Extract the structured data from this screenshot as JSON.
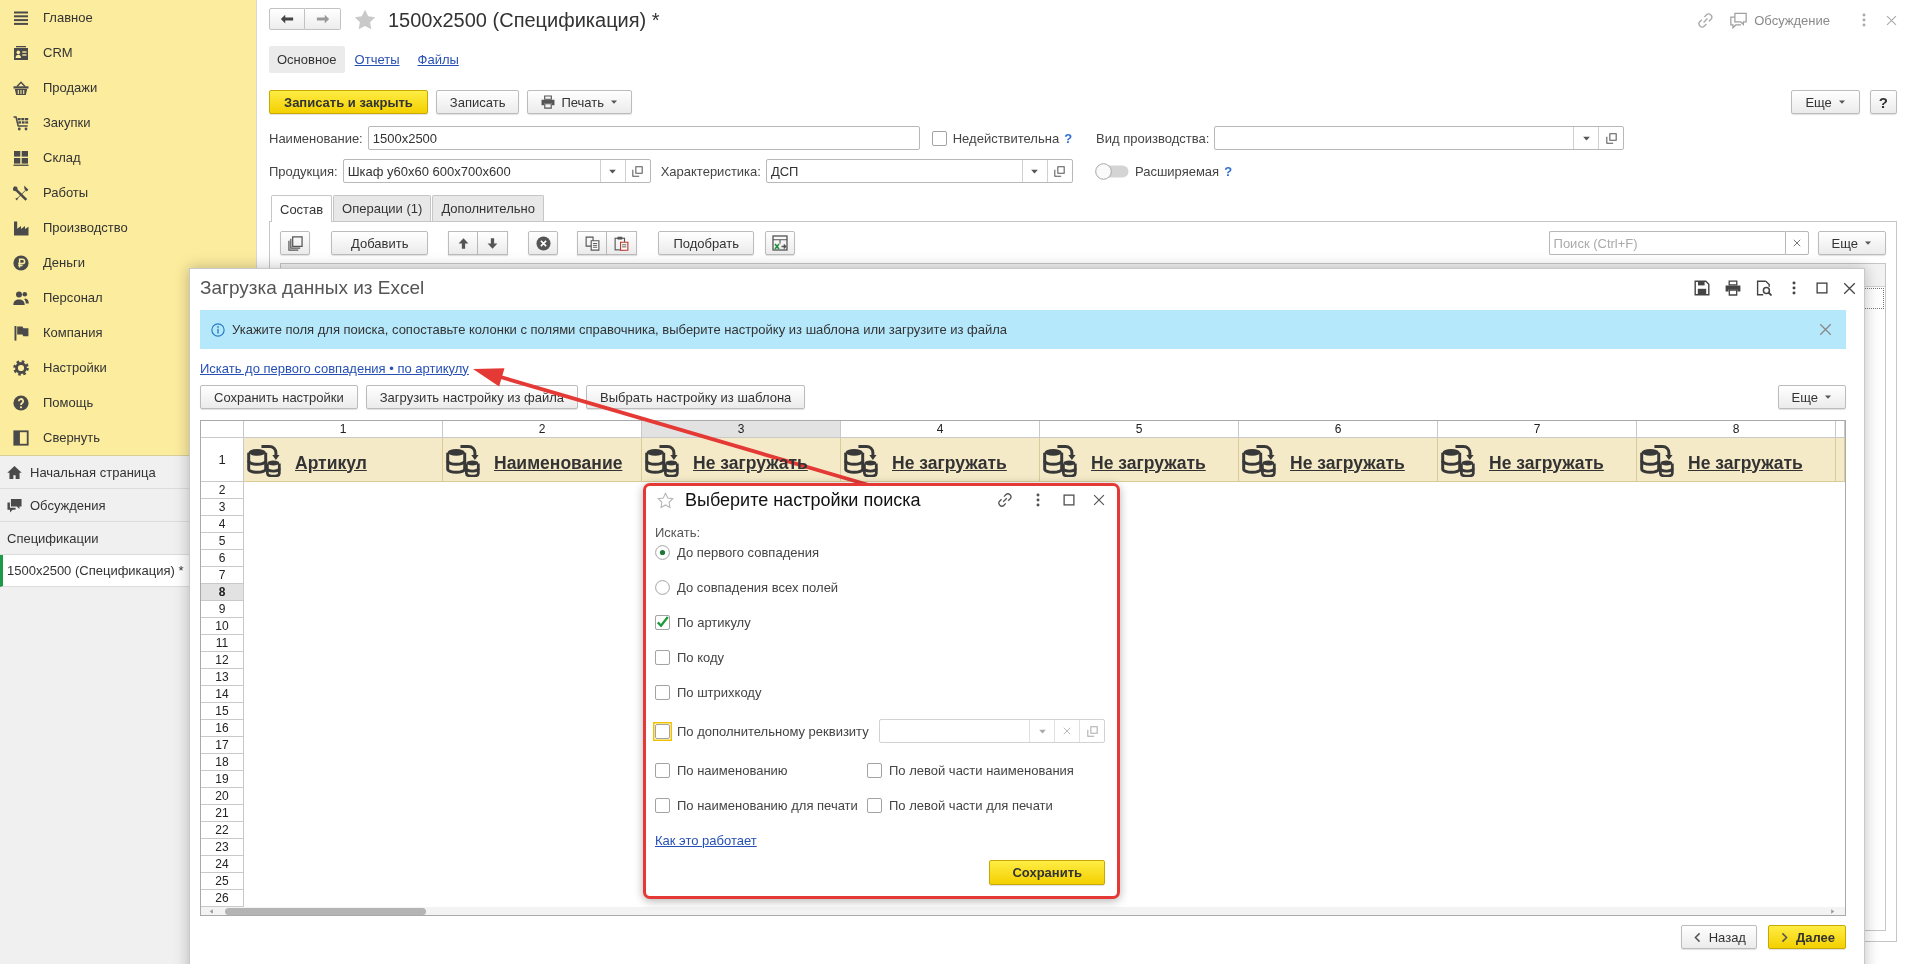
{
  "sidebar": {
    "sections": [
      {
        "label": "Главное"
      },
      {
        "label": "CRM"
      },
      {
        "label": "Продажи"
      },
      {
        "label": "Закупки"
      },
      {
        "label": "Склад"
      },
      {
        "label": "Работы"
      },
      {
        "label": "Производство"
      },
      {
        "label": "Деньги"
      },
      {
        "label": "Персонал"
      },
      {
        "label": "Компания"
      },
      {
        "label": "Настройки"
      },
      {
        "label": "Помощь"
      },
      {
        "label": "Свернуть"
      }
    ],
    "shortcuts": [
      {
        "label": "Начальная страница"
      },
      {
        "label": "Обсуждения"
      }
    ],
    "group_title": "Спецификации",
    "windows": [
      {
        "label": "1500x2500 (Спецификация) *",
        "selected": true
      }
    ]
  },
  "form": {
    "title": "1500x2500 (Спецификация) *",
    "discussion": "Обсуждение",
    "nav_tabs": [
      {
        "label": "Основное",
        "selected": true
      },
      {
        "label": "Отчеты",
        "selected": false
      },
      {
        "label": "Файлы",
        "selected": false
      }
    ],
    "commands": [
      {
        "label": "Записать и закрыть",
        "kind": "primary"
      },
      {
        "label": "Записать",
        "kind": "plain"
      },
      {
        "label": "Печать",
        "kind": "menu"
      }
    ],
    "more": "Еще",
    "help": "?",
    "name": {
      "label": "Наименование:",
      "value": "1500x2500"
    },
    "invalid": {
      "label": "Недействительна",
      "checked": false,
      "help": "?"
    },
    "production_type": {
      "label": "Вид производства:"
    },
    "product": {
      "label": "Продукция:",
      "value": "Шкаф у60х60 600х700х600"
    },
    "characteristic": {
      "label": "Характеристика:",
      "value": "ДСП"
    },
    "extendable": {
      "label": "Расширяемая",
      "on": false,
      "help": "?"
    },
    "tabs": [
      {
        "label": "Состав",
        "selected": true
      },
      {
        "label": "Операции (1)",
        "selected": false
      },
      {
        "label": "Дополнительно",
        "selected": false
      }
    ],
    "table_toolbar": {
      "add": "Добавить",
      "pick": "Подобрать",
      "search": {
        "placeholder": "Поиск (Ctrl+F)"
      },
      "more": "Еще"
    }
  },
  "import_dialog": {
    "title": "Загрузка данных из Excel",
    "info": "Укажите поля для поиска, сопоставьте колонки с полями справочника, выберите настройку из шаблона или загрузите из файла",
    "search_link": "Искать до первого совпадения • по артикулу",
    "buttons": [
      "Сохранить настройки",
      "Загрузить настройку из файла",
      "Выбрать настройку из шаблона"
    ],
    "more": "Еще",
    "columns": [
      {
        "number": "1",
        "field": "Артикул",
        "selected": false
      },
      {
        "number": "2",
        "field": "Наименование",
        "selected": false
      },
      {
        "number": "3",
        "field": "Не загружать",
        "selected": true
      },
      {
        "number": "4",
        "field": "Не загружать",
        "selected": false
      },
      {
        "number": "5",
        "field": "Не загружать",
        "selected": false
      },
      {
        "number": "6",
        "field": "Не загружать",
        "selected": false
      },
      {
        "number": "7",
        "field": "Не загружать",
        "selected": false
      },
      {
        "number": "8",
        "field": "Не загружать",
        "selected": false
      }
    ],
    "header_row": {
      "number": "1"
    },
    "rows": [
      {
        "number": "2",
        "selected": false
      },
      {
        "number": "3",
        "selected": false
      },
      {
        "number": "4",
        "selected": false
      },
      {
        "number": "5",
        "selected": false
      },
      {
        "number": "6",
        "selected": false
      },
      {
        "number": "7",
        "selected": false
      },
      {
        "number": "8",
        "selected": true
      },
      {
        "number": "9",
        "selected": false
      },
      {
        "number": "10",
        "selected": false
      },
      {
        "number": "11",
        "selected": false
      },
      {
        "number": "12",
        "selected": false
      },
      {
        "number": "13",
        "selected": false
      },
      {
        "number": "14",
        "selected": false
      },
      {
        "number": "15",
        "selected": false
      },
      {
        "number": "16",
        "selected": false
      },
      {
        "number": "17",
        "selected": false
      },
      {
        "number": "18",
        "selected": false
      },
      {
        "number": "19",
        "selected": false
      },
      {
        "number": "20",
        "selected": false
      },
      {
        "number": "21",
        "selected": false
      },
      {
        "number": "22",
        "selected": false
      },
      {
        "number": "23",
        "selected": false
      },
      {
        "number": "24",
        "selected": false
      },
      {
        "number": "25",
        "selected": false
      },
      {
        "number": "26",
        "selected": false
      }
    ],
    "back": "Назад",
    "next": "Далее"
  },
  "search_dialog": {
    "title": "Выберите настройки поиска",
    "search_label": "Искать:",
    "modes": [
      {
        "label": "До первого совпадения",
        "selected": true
      },
      {
        "label": "До совпадения всех полей",
        "selected": false
      }
    ],
    "options": [
      {
        "label": "По артикулу",
        "kind": "plain",
        "checked": true,
        "focused": false
      },
      {
        "label": "По коду",
        "kind": "plain",
        "checked": false,
        "focused": false
      },
      {
        "label": "По штрихкоду",
        "kind": "plain",
        "checked": false,
        "focused": false
      },
      {
        "label": "По дополнительному реквизиту",
        "kind": "lookup",
        "checked": false,
        "focused": true
      }
    ],
    "name_options": [
      {
        "label": "По наименованию",
        "checked": false
      },
      {
        "label": "По левой части наименования",
        "checked": false
      },
      {
        "label": "По наименованию для печати",
        "checked": false
      },
      {
        "label": "По левой части для печати",
        "checked": false
      }
    ],
    "help_link": "Как это работает",
    "save": "Сохранить"
  }
}
